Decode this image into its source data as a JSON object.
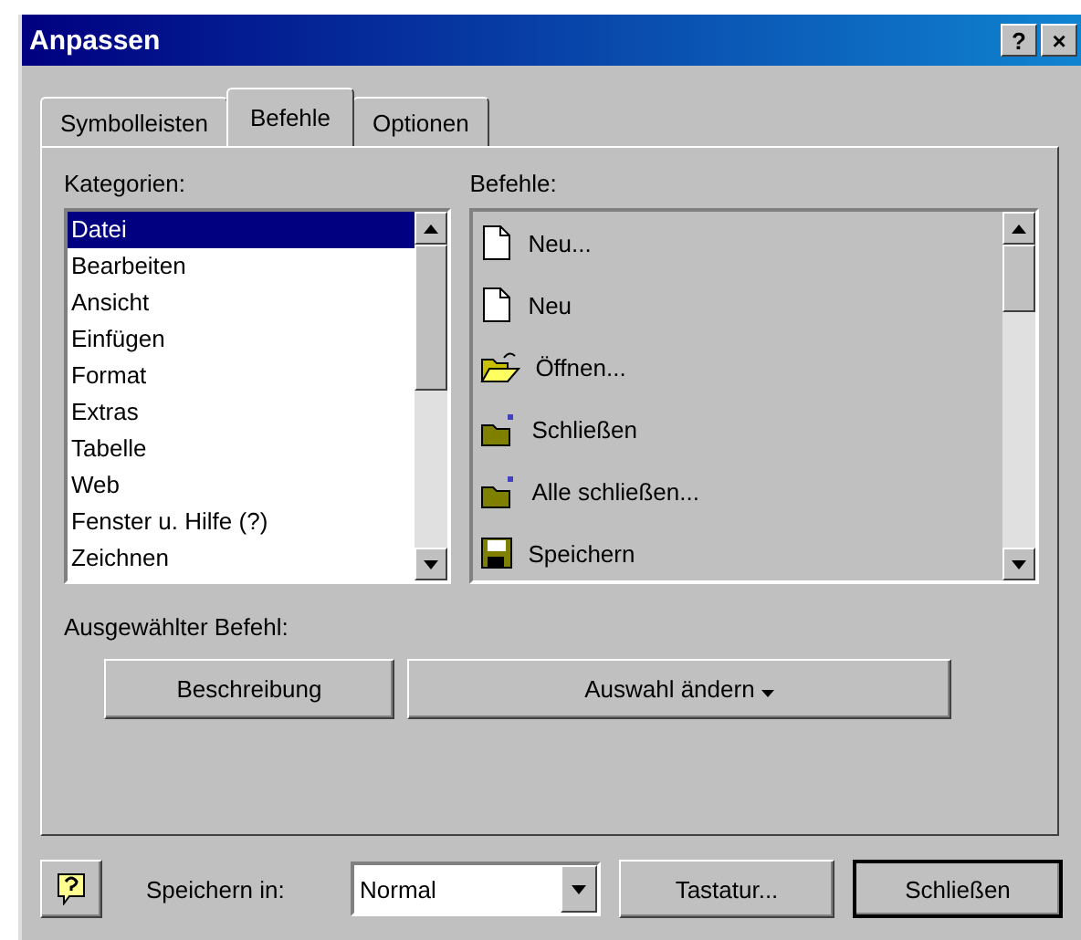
{
  "window": {
    "title": "Anpassen",
    "title_buttons": [
      "?",
      "×"
    ]
  },
  "tabs": [
    {
      "label": "Symbolleisten",
      "selected": false
    },
    {
      "label": "Befehle",
      "selected": true
    },
    {
      "label": "Optionen",
      "selected": false
    }
  ],
  "categories": {
    "label": "Kategorien:",
    "items": [
      {
        "label": "Datei",
        "selected": true
      },
      {
        "label": "Bearbeiten",
        "selected": false
      },
      {
        "label": "Ansicht",
        "selected": false
      },
      {
        "label": "Einfügen",
        "selected": false
      },
      {
        "label": "Format",
        "selected": false
      },
      {
        "label": "Extras",
        "selected": false
      },
      {
        "label": "Tabelle",
        "selected": false
      },
      {
        "label": "Web",
        "selected": false
      },
      {
        "label": "Fenster u. Hilfe (?)",
        "selected": false
      },
      {
        "label": "Zeichnen",
        "selected": false
      }
    ]
  },
  "commands": {
    "label": "Befehle:",
    "items": [
      {
        "label": "Neu...",
        "kind": "document"
      },
      {
        "label": "Neu",
        "kind": "document"
      },
      {
        "label": "Öffnen...",
        "kind": "open-folder"
      },
      {
        "label": "Schließen",
        "kind": "folder"
      },
      {
        "label": "Alle schließen...",
        "kind": "folder"
      },
      {
        "label": "Speichern",
        "kind": "disk"
      }
    ]
  },
  "selected_command": {
    "label": "Ausgewählter Befehl:",
    "buttons": [
      "Beschreibung",
      "Auswahl ändern"
    ]
  },
  "footer": {
    "save_in_label": "Speichern in:",
    "save_in_value": "Normal",
    "buttons": [
      "Tastatur...",
      "Schließen"
    ]
  }
}
